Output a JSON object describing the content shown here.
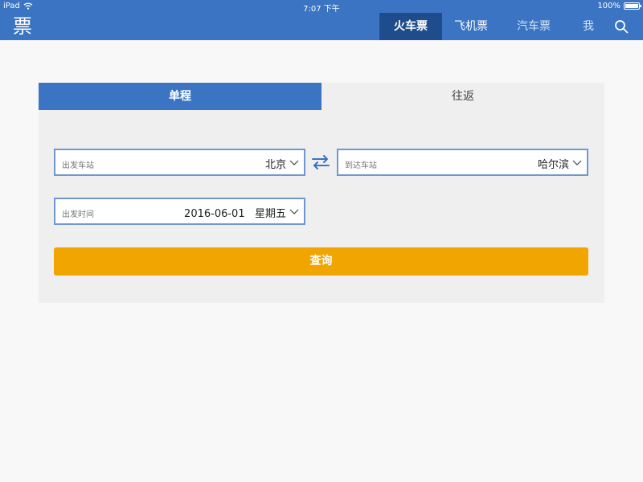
{
  "status_bar": {
    "device": "iPad",
    "time": "7:07 下午",
    "battery": "100%"
  },
  "nav": {
    "logo": "票",
    "tabs": [
      {
        "label": "火车票",
        "active": true
      },
      {
        "label": "飞机票",
        "active": false
      },
      {
        "label": "汽车票",
        "active": false
      },
      {
        "label": "我",
        "active": false
      }
    ]
  },
  "trip_type": {
    "one_way": "单程",
    "round_trip": "往返"
  },
  "form": {
    "departure": {
      "label": "出发车站",
      "value": "北京"
    },
    "arrival": {
      "label": "到达车站",
      "value": "哈尔滨"
    },
    "date": {
      "label": "出发时间",
      "value": "2016-06-01   星期五"
    },
    "submit": "查询"
  },
  "colors": {
    "primary": "#3a74c2",
    "nav_active": "#1e4c8c",
    "accent": "#f0a500",
    "field_border": "#6f97d0"
  }
}
